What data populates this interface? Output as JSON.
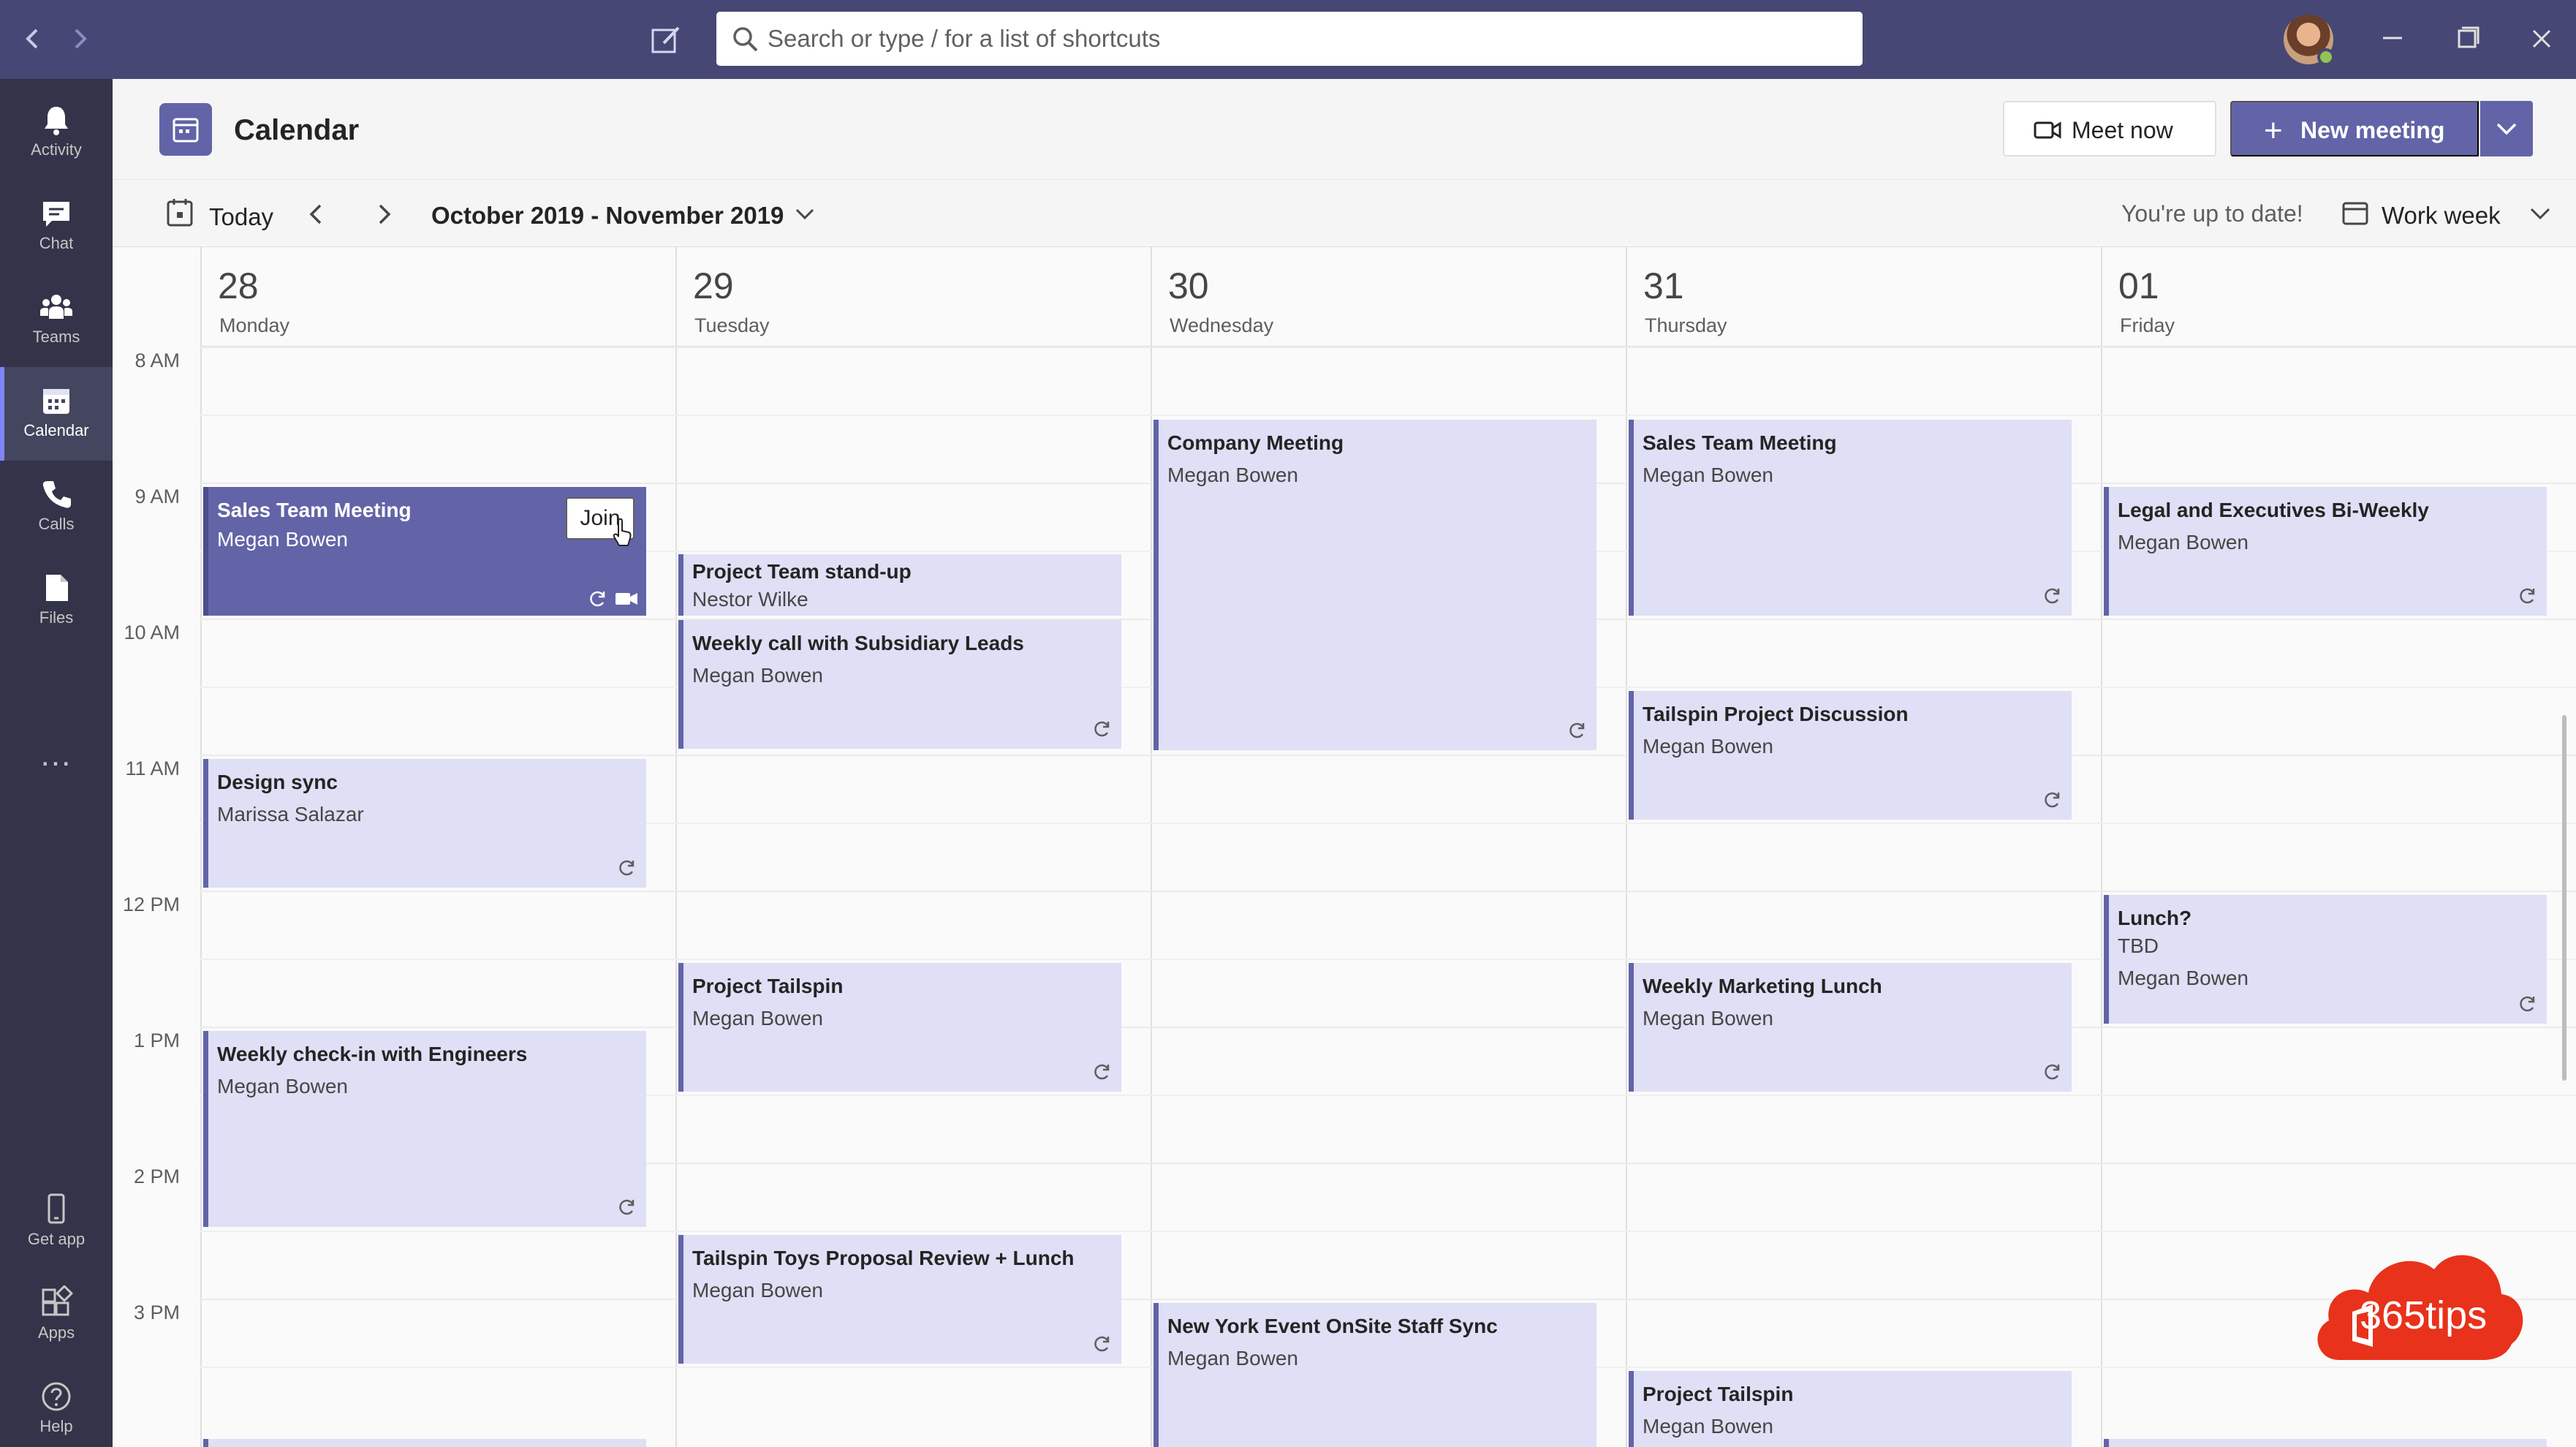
{
  "titlebar": {
    "search_placeholder": "Search or type / for a list of shortcuts"
  },
  "rail": {
    "items": [
      {
        "label": "Activity",
        "icon": "bell-icon"
      },
      {
        "label": "Chat",
        "icon": "chat-icon"
      },
      {
        "label": "Teams",
        "icon": "teams-icon"
      },
      {
        "label": "Calendar",
        "icon": "calendar-icon"
      },
      {
        "label": "Calls",
        "icon": "phone-icon"
      },
      {
        "label": "Files",
        "icon": "files-icon"
      },
      {
        "label": "Get app",
        "icon": "mobile-icon"
      },
      {
        "label": "Apps",
        "icon": "apps-icon"
      },
      {
        "label": "Help",
        "icon": "help-icon"
      }
    ],
    "more": "..."
  },
  "header": {
    "title": "Calendar",
    "meet_now": "Meet now",
    "new_meeting": "New meeting"
  },
  "toolbar": {
    "today": "Today",
    "date_range": "October 2019 - November 2019",
    "status": "You're up to date!",
    "view": "Work week"
  },
  "days": [
    {
      "num": "28",
      "name": "Monday"
    },
    {
      "num": "29",
      "name": "Tuesday"
    },
    {
      "num": "30",
      "name": "Wednesday"
    },
    {
      "num": "31",
      "name": "Thursday"
    },
    {
      "num": "01",
      "name": "Friday"
    }
  ],
  "times": [
    "8 AM",
    "9 AM",
    "10 AM",
    "11 AM",
    "12 PM",
    "1 PM",
    "2 PM",
    "3 PM"
  ],
  "events": {
    "mon_sales": {
      "title": "Sales Team Meeting",
      "organizer": "Megan Bowen",
      "join": "Join"
    },
    "mon_design": {
      "title": "Design sync",
      "organizer": "Marissa Salazar"
    },
    "mon_engineers": {
      "title": "Weekly check-in with Engineers",
      "organizer": "Megan Bowen"
    },
    "tue_standup": {
      "title": "Project Team stand-up",
      "organizer": "Nestor Wilke"
    },
    "tue_subsidiary": {
      "title": "Weekly call with Subsidiary Leads",
      "organizer": "Megan Bowen"
    },
    "tue_tailspin": {
      "title": "Project Tailspin",
      "organizer": "Megan Bowen"
    },
    "tue_proposal": {
      "title": "Tailspin Toys Proposal Review + Lunch",
      "organizer": "Megan Bowen"
    },
    "wed_company": {
      "title": "Company Meeting",
      "organizer": "Megan Bowen"
    },
    "wed_newyork": {
      "title": "New York Event OnSite Staff Sync",
      "organizer": "Megan Bowen"
    },
    "thu_sales": {
      "title": "Sales Team Meeting",
      "organizer": "Megan Bowen"
    },
    "thu_discussion": {
      "title": "Tailspin Project Discussion",
      "organizer": "Megan Bowen"
    },
    "thu_marketing": {
      "title": "Weekly Marketing Lunch",
      "organizer": "Megan Bowen"
    },
    "thu_tailspin": {
      "title": "Project Tailspin",
      "organizer": "Megan Bowen"
    },
    "fri_legal": {
      "title": "Legal and Executives Bi-Weekly",
      "organizer": "Megan Bowen"
    },
    "fri_lunch": {
      "title": "Lunch?",
      "location": "TBD",
      "organizer": "Megan Bowen"
    }
  },
  "watermark": {
    "text": "365tips"
  },
  "colors": {
    "titlebar": "#464775",
    "rail": "#33344a",
    "accent": "#6264a7",
    "event_fill": "#dfdff6",
    "watermark": "#e8321b"
  }
}
